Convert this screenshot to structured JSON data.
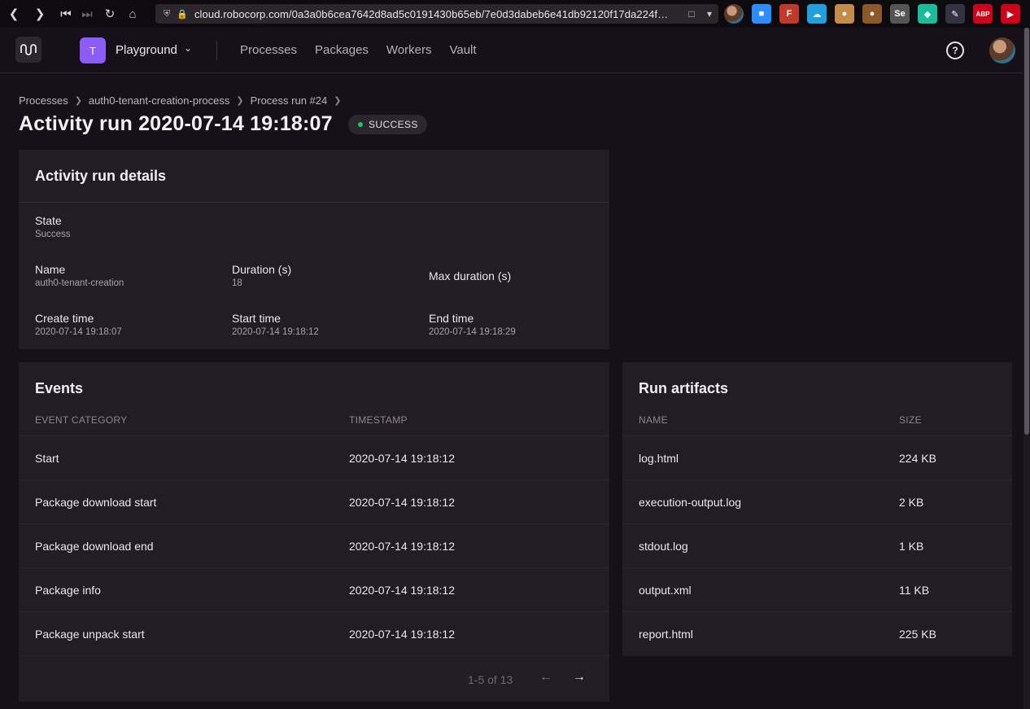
{
  "browser": {
    "url": "cloud.robocorp.com/0a3a0b6cea7642d8ad5c0191430b65eb/7e0d3dabeb6e41db92120f17da224f…",
    "extensions": [
      {
        "name": "zoom-extension-icon",
        "color": "#2d8cff",
        "glyph": "■"
      },
      {
        "name": "fb-extension-icon",
        "color": "#c0392b",
        "glyph": "F"
      },
      {
        "name": "salesforce-extension-icon",
        "color": "#1ea0e0",
        "glyph": "☁"
      },
      {
        "name": "cookie-extension-icon",
        "color": "#c58b4b",
        "glyph": "●"
      },
      {
        "name": "cookie2-extension-icon",
        "color": "#8b5a2b",
        "glyph": "●"
      },
      {
        "name": "selenium-extension-icon",
        "color": "#555",
        "glyph": "Se"
      },
      {
        "name": "bot-extension-icon",
        "color": "#1abc9c",
        "glyph": "◆"
      },
      {
        "name": "pen-extension-icon",
        "color": "#334",
        "glyph": "✎"
      },
      {
        "name": "abp-extension-icon",
        "color": "#d0021b",
        "glyph": "ABP"
      },
      {
        "name": "media-extension-icon",
        "color": "#d0021b",
        "glyph": "▶"
      }
    ]
  },
  "header": {
    "workspace_initial": "T",
    "workspace_name": "Playground",
    "nav": [
      "Processes",
      "Packages",
      "Workers",
      "Vault"
    ],
    "help_glyph": "?"
  },
  "breadcrumb": [
    "Processes",
    "auth0-tenant-creation-process",
    "Process run #24"
  ],
  "page_title": "Activity run 2020-07-14 19:18:07",
  "status": "SUCCESS",
  "details": {
    "title": "Activity run details",
    "state_label": "State",
    "state_value": "Success",
    "name_label": "Name",
    "name_value": "auth0-tenant-creation",
    "duration_label": "Duration (s)",
    "duration_value": "18",
    "max_duration_label": "Max duration (s)",
    "create_label": "Create time",
    "create_value": "2020-07-14 19:18:07",
    "start_label": "Start time",
    "start_value": "2020-07-14 19:18:12",
    "end_label": "End time",
    "end_value": "2020-07-14 19:18:29"
  },
  "events": {
    "title": "Events",
    "col_category": "EVENT CATEGORY",
    "col_timestamp": "TIMESTAMP",
    "rows": [
      {
        "category": "Start",
        "timestamp": "2020-07-14 19:18:12"
      },
      {
        "category": "Package download start",
        "timestamp": "2020-07-14 19:18:12"
      },
      {
        "category": "Package download end",
        "timestamp": "2020-07-14 19:18:12"
      },
      {
        "category": "Package info",
        "timestamp": "2020-07-14 19:18:12"
      },
      {
        "category": "Package unpack start",
        "timestamp": "2020-07-14 19:18:12"
      }
    ],
    "pager_text": "1-5 of 13"
  },
  "artifacts": {
    "title": "Run artifacts",
    "col_name": "NAME",
    "col_size": "SIZE",
    "rows": [
      {
        "name": "log.html",
        "size": "224 KB"
      },
      {
        "name": "execution-output.log",
        "size": "2 KB"
      },
      {
        "name": "stdout.log",
        "size": "1 KB"
      },
      {
        "name": "output.xml",
        "size": "11 KB"
      },
      {
        "name": "report.html",
        "size": "225 KB"
      }
    ]
  }
}
